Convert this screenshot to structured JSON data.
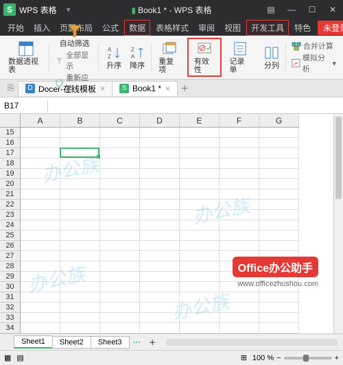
{
  "title": {
    "app": "WPS 表格",
    "logo": "S",
    "doc": "Book1 * - WPS 表格"
  },
  "menu": {
    "items": [
      "开始",
      "插入",
      "页面布局",
      "公式",
      "数据",
      "表格样式",
      "审阅",
      "视图",
      "开发工具",
      "特色"
    ],
    "highlight": [
      "数据",
      "开发工具"
    ],
    "login": "未登录"
  },
  "ribbon": {
    "pivot": "数据透视表",
    "autofilter": "自动筛选",
    "filter_menu": [
      "全部显示",
      "重新应用"
    ],
    "asc": "升序",
    "desc": "降序",
    "duplicate": "重复项",
    "validity": "有效性",
    "record": "记录单",
    "texttocols": "分列",
    "consolidate": "合并计算",
    "whatif": "模拟分析"
  },
  "doctabs": {
    "pin": "⎘",
    "tab1": {
      "label": "Docer-在线模板",
      "icon": "D"
    },
    "tab2": {
      "label": "Book1 *",
      "icon": "S"
    }
  },
  "namebox": "B17",
  "columns": [
    "A",
    "B",
    "C",
    "D",
    "E",
    "F",
    "G"
  ],
  "rows_start": 15,
  "rows_end": 34,
  "selected": {
    "col": 1,
    "rowIndex": 2
  },
  "sheets": [
    "Sheet1",
    "Sheet2",
    "Sheet3"
  ],
  "watermark": "办公族",
  "brand": {
    "title_en": "Office",
    "title_cn": "办公助手",
    "url": "www.officezhushou.com"
  },
  "status": {
    "zoom": "100 %"
  }
}
